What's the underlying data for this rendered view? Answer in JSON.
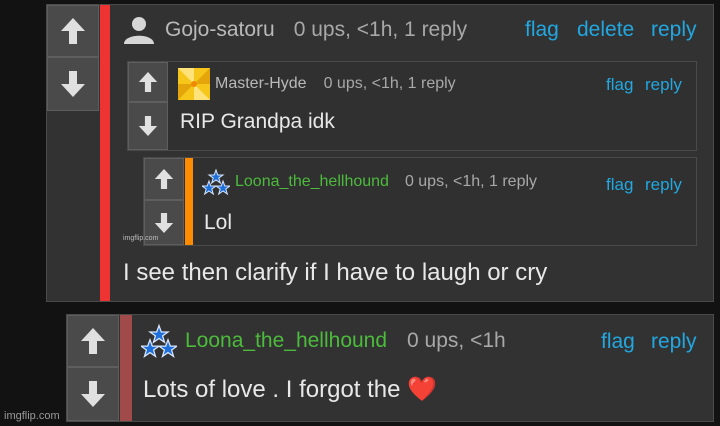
{
  "watermark": "imgflip.com",
  "colors": {
    "link": "#22a7e0",
    "username_green": "#4cbb3c",
    "stripe_red": "#ee3333",
    "stripe_orange": "#ff8c00",
    "stripe_dark_red": "#a04a4a"
  },
  "comments": [
    {
      "username": "Gojo-satoru",
      "meta": "0 ups, <1h, 1 reply",
      "actions": {
        "flag": "flag",
        "delete": "delete",
        "reply": "reply"
      },
      "text": "I see then clarify if I have to laugh or cry",
      "avatar": "default-user-icon",
      "replies": [
        {
          "username": "Master-Hyde",
          "meta": "0 ups, <1h, 1 reply",
          "actions": {
            "flag": "flag",
            "reply": "reply"
          },
          "text": "RIP Grandpa idk",
          "avatar": "yellow-pinwheel-avatar"
        },
        {
          "username": "Loona_the_hellhound",
          "meta": "0 ups, <1h, 1 reply",
          "actions": {
            "flag": "flag",
            "reply": "reply"
          },
          "text": "Lol",
          "avatar": "blue-stars-avatar"
        }
      ]
    },
    {
      "username": "Loona_the_hellhound",
      "meta": "0 ups, <1h",
      "actions": {
        "flag": "flag",
        "reply": "reply"
      },
      "text": "Lots of love . I forgot the ❤️",
      "avatar": "blue-stars-avatar"
    }
  ]
}
